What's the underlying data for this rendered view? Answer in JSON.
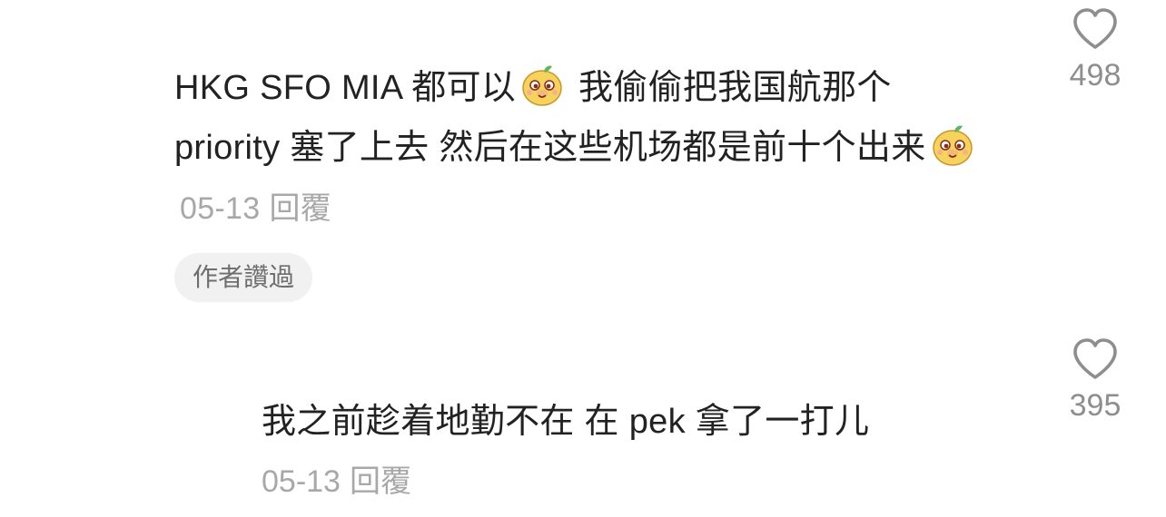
{
  "comments": [
    {
      "text_part1": "HKG SFO MIA 都可以",
      "text_part2": " 我偷偷把我国航那个 priority 塞了上去 然后在这些机场都是前十个出来",
      "emoji_icon": "smiling-mascot-emoji",
      "date": "05-13",
      "reply_label": "回覆",
      "badge": "作者讚過",
      "like_count": "498"
    },
    {
      "text": "我之前趁着地勤不在 在 pek 拿了一打儿",
      "date": "05-13",
      "reply_label": "回覆",
      "like_count": "395"
    }
  ],
  "colors": {
    "text": "#222222",
    "meta": "#a8a8a8",
    "badge_bg": "#f1f1f1",
    "heart_stroke": "#8e8e8e"
  },
  "icons": [
    "heart-outline-icon",
    "smiling-mascot-emoji"
  ]
}
